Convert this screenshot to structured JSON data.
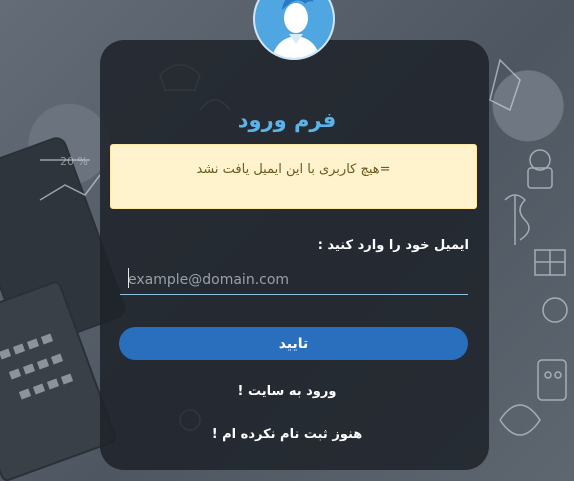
{
  "form": {
    "title": "فرم ورود",
    "alert_message": "=هیچ کاربری با این ایمیل یافت نشد",
    "email_label": "ایمیل خود را وارد کنید :",
    "email_placeholder": "example@domain.com",
    "email_value": "",
    "submit_label": "تایید",
    "site_link": "ورود به سایت !",
    "signup_link": "هنوز ثبت نام نکرده ام !"
  },
  "colors": {
    "accent": "#5cb3ea",
    "button": "#2a6fbe",
    "alert_bg": "#fff3cd"
  },
  "icons": {
    "avatar": "user-avatar-icon",
    "background": "business-doodle-illustration"
  }
}
